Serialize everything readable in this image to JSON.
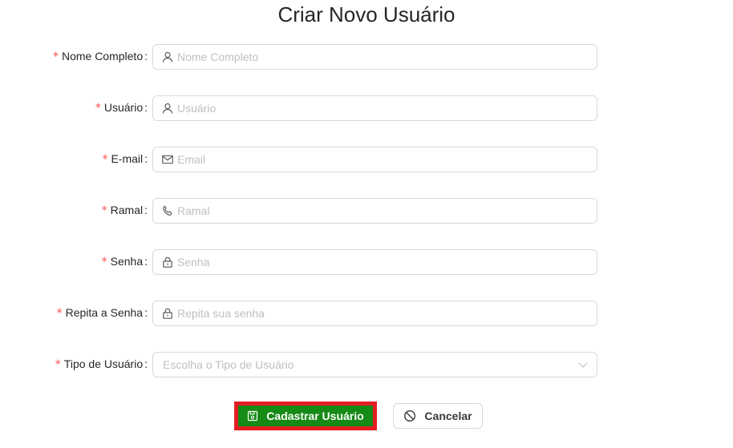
{
  "page": {
    "title": "Criar Novo Usuário"
  },
  "form": {
    "fields": [
      {
        "label": "Nome Completo",
        "placeholder": "Nome Completo",
        "icon": "user-icon",
        "value": ""
      },
      {
        "label": "Usuário",
        "placeholder": "Usuário",
        "icon": "user-icon",
        "value": ""
      },
      {
        "label": "E-mail",
        "placeholder": "Email",
        "icon": "mail-icon",
        "value": ""
      },
      {
        "label": "Ramal",
        "placeholder": "Ramal",
        "icon": "phone-icon",
        "value": ""
      },
      {
        "label": "Senha",
        "placeholder": "Senha",
        "icon": "lock-icon",
        "value": ""
      },
      {
        "label": "Repita a Senha",
        "placeholder": "Repita sua senha",
        "icon": "lock-icon",
        "value": ""
      }
    ],
    "select": {
      "label": "Tipo de Usuário",
      "placeholder": "Escolha o Tipo de Usuário",
      "icon": "chevron-down-icon"
    },
    "required_mark": "*",
    "colon": ":"
  },
  "actions": {
    "submit_label": "Cadastrar Usuário",
    "submit_icon": "save-icon",
    "cancel_label": "Cancelar",
    "cancel_icon": "stop-icon"
  },
  "colors": {
    "primary": "#168a16",
    "highlight": "#e41c23",
    "required": "#ff4d4f"
  }
}
